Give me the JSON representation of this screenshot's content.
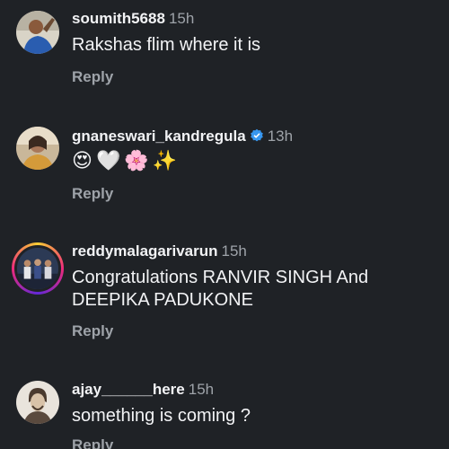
{
  "comments": [
    {
      "username": "soumith5688",
      "time": "15h",
      "text": "Rakshas flim where it is",
      "reply_label": "Reply",
      "avatar_icon": "avatar-photo-man-blue-shirt"
    },
    {
      "username": "gnaneswari_kandregula",
      "verified": true,
      "time": "13h",
      "emojis": [
        "😍",
        "🤍",
        "🌸",
        "✨"
      ],
      "reply_label": "Reply",
      "avatar_icon": "avatar-photo-woman"
    },
    {
      "username": "reddymalagarivarun",
      "time": "15h",
      "text_line1": "Congratulations RANVIR SINGH And",
      "text_line2": "DEEPIKA PADUKONE",
      "reply_label": "Reply",
      "avatar_icon": "avatar-photo-group-story-ring"
    },
    {
      "username": "ajay______here",
      "time": "15h",
      "text": "something is coming ?",
      "reply_label": "Reply",
      "avatar_icon": "avatar-sketch-man"
    }
  ],
  "colors": {
    "background": "#1f2226",
    "primary_text": "#f2f3f5",
    "secondary_text": "#9ea3a9",
    "verified_badge": "#3797f0"
  }
}
